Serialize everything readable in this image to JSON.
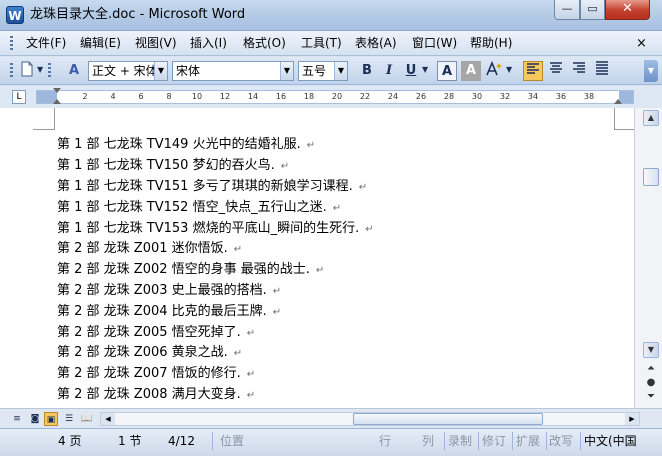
{
  "window": {
    "title": "龙珠目录大全.doc - Microsoft Word",
    "app_icon_letter": "W",
    "minimize_glyph": "—",
    "maximize_glyph": "▭",
    "close_glyph": "✕"
  },
  "menu": {
    "items": [
      "文件(F)",
      "编辑(E)",
      "视图(V)",
      "插入(I)",
      "格式(O)",
      "工具(T)",
      "表格(A)",
      "窗口(W)",
      "帮助(H)"
    ],
    "close_doc_glyph": "×"
  },
  "toolbar": {
    "style_value": "正文 + 宋体",
    "font_value": "宋体",
    "size_value": "五号",
    "bold_label": "B",
    "italic_label": "I",
    "underline_label": "U",
    "font_color_label": "A",
    "char_shading_label": "A",
    "styles_icon_label": "A"
  },
  "ruler": {
    "ticks": [
      "2",
      "4",
      "6",
      "8",
      "10",
      "12",
      "14",
      "16",
      "18",
      "20",
      "22",
      "24",
      "26",
      "28",
      "30",
      "32",
      "34",
      "36",
      "38"
    ],
    "tab_selector_glyph": "L"
  },
  "document": {
    "lines": [
      "第 1 部  七龙珠 TV149  火光中的结婚礼服.",
      "第 1 部  七龙珠 TV150  梦幻的吞火鸟.",
      "第 1 部  七龙珠 TV151  多亏了琪琪的新娘学习课程.",
      "第 1 部  七龙珠 TV152  悟空_快点_五行山之迷.",
      "第 1 部  七龙珠 TV153  燃烧的平底山_瞬间的生死行.",
      "第 2 部  龙珠 Z001  迷你悟饭.",
      "第 2 部  龙珠 Z002  悟空的身事  最强的战士.",
      "第 2 部  龙珠 Z003  史上最强的搭档.",
      "第 2 部  龙珠 Z004  比克的最后王牌.",
      "第 2 部  龙珠 Z005  悟空死掉了.",
      "第 2 部  龙珠 Z006  黄泉之战.",
      "第 2 部  龙珠 Z007  悟饭的修行.",
      "第 2 部  龙珠 Z008  满月大变身."
    ],
    "paragraph_mark": "↵"
  },
  "statusbar": {
    "page": "4 页",
    "section": "1 节",
    "page_of": "4/12",
    "position": "位置",
    "line": "行",
    "column": "列",
    "record": "录制",
    "revise": "修订",
    "extend": "扩展",
    "overwrite": "改写",
    "language": "中文(中国"
  }
}
